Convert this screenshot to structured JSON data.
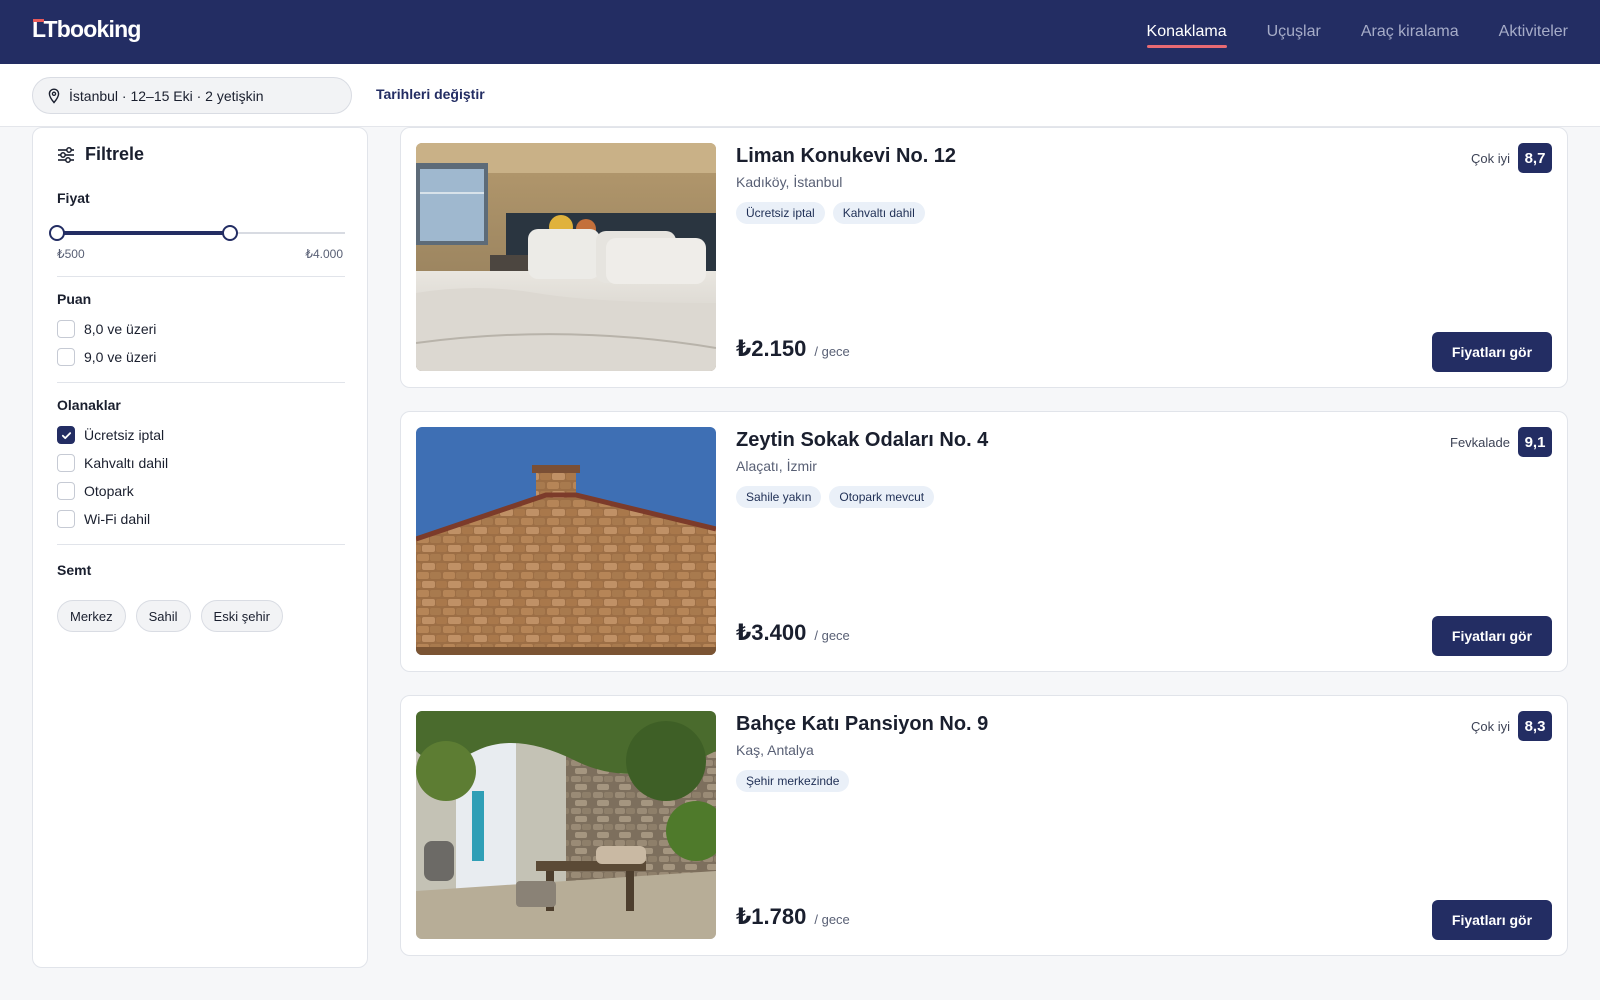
{
  "header": {
    "logo": "LTbooking",
    "nav": [
      "Konaklama",
      "Uçuşlar",
      "Araç kiralama",
      "Aktiviteler"
    ],
    "active_nav": "Konaklama"
  },
  "search": {
    "summary": "İstanbul · 12–15 Eki · 2 yetişkin",
    "change_dates": "Tarihleri değiştir"
  },
  "filters": {
    "title": "Filtrele",
    "price": {
      "title": "Fiyat",
      "min_label": "₺500",
      "max_label": "₺4.000",
      "selected_min_fraction": 0,
      "selected_max_fraction": 0.6
    },
    "rating": {
      "title": "Puan",
      "options": [
        {
          "label": "8,0 ve üzeri",
          "checked": false
        },
        {
          "label": "9,0 ve üzeri",
          "checked": false
        }
      ]
    },
    "amenities": {
      "title": "Olanaklar",
      "options": [
        {
          "label": "Ücretsiz iptal",
          "checked": true
        },
        {
          "label": "Kahvaltı dahil",
          "checked": false
        },
        {
          "label": "Otopark",
          "checked": false
        },
        {
          "label": "Wi-Fi dahil",
          "checked": false
        }
      ]
    },
    "district": {
      "title": "Semt",
      "chips": [
        "Merkez",
        "Sahil",
        "Eski şehir"
      ]
    }
  },
  "hotels": [
    {
      "name": "Liman Konukevi No. 12",
      "location": "Kadıköy, İstanbul",
      "tags": [
        "Ücretsiz iptal",
        "Kahvaltı dahil"
      ],
      "rating_text": "Çok iyi",
      "score": "8,7",
      "price": "₺2.150",
      "per": "/ gece",
      "cta": "Fiyatları gör",
      "photo": "hotel-room-bed"
    },
    {
      "name": "Zeytin Sokak Odaları No. 4",
      "location": "Alaçatı, İzmir",
      "tags": [
        "Sahile yakın",
        "Otopark mevcut"
      ],
      "rating_text": "Fevkalade",
      "score": "9,1",
      "price": "₺3.400",
      "per": "/ gece",
      "cta": "Fiyatları gör",
      "photo": "stone-house-wall"
    },
    {
      "name": "Bahçe Katı Pansiyon No. 9",
      "location": "Kaş, Antalya",
      "tags": [
        "Şehir merkezinde"
      ],
      "rating_text": "Çok iyi",
      "score": "8,3",
      "price": "₺1.780",
      "per": "/ gece",
      "cta": "Fiyatları gör",
      "photo": "garden-courtyard"
    }
  ],
  "colors": {
    "brand": "#232d63",
    "accent": "#e86a73",
    "tag_bg": "#eaf0f8"
  }
}
